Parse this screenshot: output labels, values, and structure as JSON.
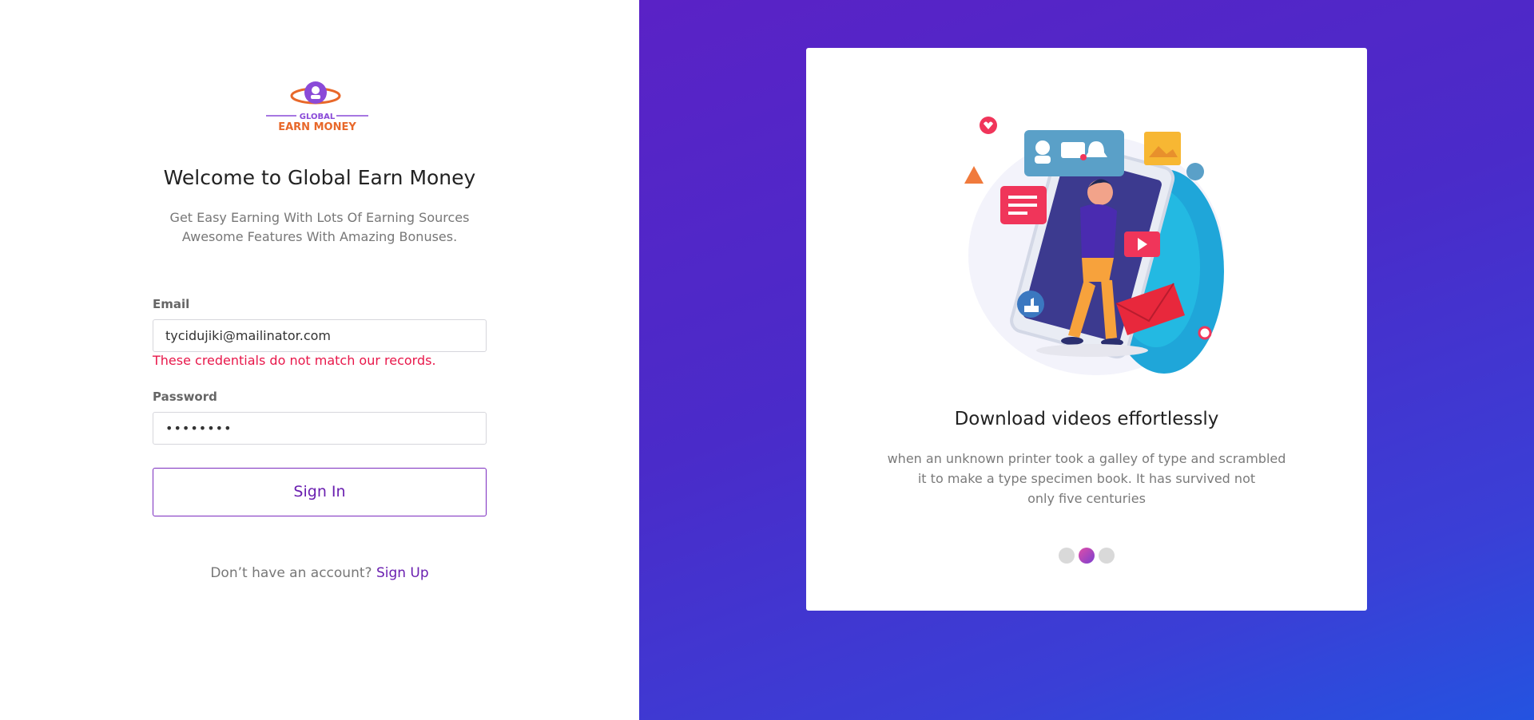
{
  "logo": {
    "top_text": "GLOBAL",
    "bottom_text": "EARN MONEY"
  },
  "welcome": {
    "title": "Welcome to Global Earn Money",
    "subtitle_line1": "Get Easy Earning With Lots Of Earning Sources",
    "subtitle_line2": "Awesome Features With Amazing Bonuses."
  },
  "form": {
    "email_label": "Email",
    "email_value": "tycidujiki@mailinator.com",
    "error_message": "These credentials do not match our records.",
    "password_label": "Password",
    "password_value": "••••••••",
    "signin_label": "Sign In"
  },
  "signup": {
    "prompt": "Don’t have an account?",
    "link_label": "Sign Up"
  },
  "slide": {
    "title": "Download videos effortlessly",
    "text_line1": "when an unknown printer took a galley of type and scrambled",
    "text_line2": "it to make a type specimen book. It has survived not",
    "text_line3": "only five centuries",
    "active_dot": 2,
    "dot_count": 3
  },
  "colors": {
    "accent": "#6a1fb0",
    "error": "#e8174a",
    "gradient_start": "#5a22c6",
    "gradient_end": "#2453e0"
  },
  "icons": [
    "logo-globe-icon",
    "social-media-illustration"
  ]
}
